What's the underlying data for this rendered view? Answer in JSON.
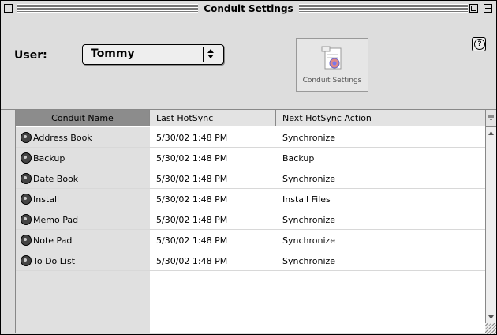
{
  "window": {
    "title": "Conduit Settings"
  },
  "toolbar": {
    "user_label": "User:",
    "user_value": "Tommy",
    "conduit_settings_label": "Conduit Settings",
    "help_glyph": "?"
  },
  "table": {
    "columns": [
      "Conduit Name",
      "Last HotSync",
      "Next HotSync Action"
    ],
    "rows": [
      {
        "name": "Address Book",
        "last": "5/30/02 1:48 PM",
        "action": "Synchronize"
      },
      {
        "name": "Backup",
        "last": "5/30/02 1:48 PM",
        "action": "Backup"
      },
      {
        "name": "Date Book",
        "last": "5/30/02 1:48 PM",
        "action": "Synchronize"
      },
      {
        "name": "Install",
        "last": "5/30/02 1:48 PM",
        "action": "Install Files"
      },
      {
        "name": "Memo Pad",
        "last": "5/30/02 1:48 PM",
        "action": "Synchronize"
      },
      {
        "name": "Note Pad",
        "last": "5/30/02 1:48 PM",
        "action": "Synchronize"
      },
      {
        "name": "To Do List",
        "last": "5/30/02 1:48 PM",
        "action": "Synchronize"
      }
    ]
  },
  "icons": {
    "close": "close-box-icon",
    "zoom": "zoom-box-icon",
    "collapse": "collapse-box-icon",
    "help": "help-icon",
    "conduit": "conduit-icon",
    "settings": "conduit-settings-icon",
    "popup_arrows": "up-down-arrows-icon"
  },
  "colors": {
    "window_bg": "#dddddd",
    "active_header": "#8c8c8c",
    "name_column_bg": "#e0e0e0"
  }
}
